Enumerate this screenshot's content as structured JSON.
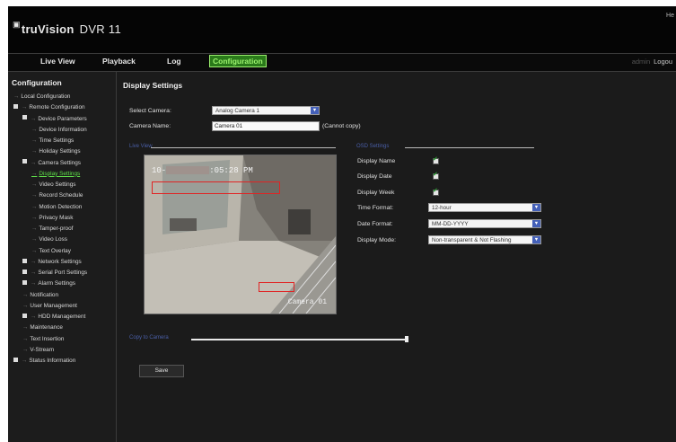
{
  "app": {
    "brand_prefix": "tru",
    "brand_word": "Vision",
    "model": "DVR 11",
    "help": "He"
  },
  "nav": {
    "items": [
      "Live View",
      "Playback",
      "Log",
      "Configuration"
    ],
    "active": "Configuration",
    "user": "admin",
    "logout": "Logou"
  },
  "sidebar": {
    "title": "Configuration",
    "items": [
      {
        "label": "Local Configuration",
        "level": 0,
        "expander": false
      },
      {
        "label": "Remote Configuration",
        "level": 0,
        "expander": true
      },
      {
        "label": "Device Parameters",
        "level": 1,
        "expander": true
      },
      {
        "label": "Device Information",
        "level": 2,
        "expander": false
      },
      {
        "label": "Time Settings",
        "level": 2,
        "expander": false
      },
      {
        "label": "Holiday Settings",
        "level": 2,
        "expander": false
      },
      {
        "label": "Camera Settings",
        "level": 1,
        "expander": true
      },
      {
        "label": "Display Settings",
        "level": 2,
        "expander": false,
        "active": true
      },
      {
        "label": "Video Settings",
        "level": 2,
        "expander": false
      },
      {
        "label": "Record Schedule",
        "level": 2,
        "expander": false
      },
      {
        "label": "Motion Detection",
        "level": 2,
        "expander": false
      },
      {
        "label": "Privacy Mask",
        "level": 2,
        "expander": false
      },
      {
        "label": "Tamper-proof",
        "level": 2,
        "expander": false
      },
      {
        "label": "Video Loss",
        "level": 2,
        "expander": false
      },
      {
        "label": "Text Overlay",
        "level": 2,
        "expander": false
      },
      {
        "label": "Network Settings",
        "level": 1,
        "expander": true
      },
      {
        "label": "Serial Port Settings",
        "level": 1,
        "expander": true
      },
      {
        "label": "Alarm Settings",
        "level": 1,
        "expander": true
      },
      {
        "label": "Notification",
        "level": 1,
        "expander": false
      },
      {
        "label": "User Management",
        "level": 1,
        "expander": false
      },
      {
        "label": "HDD Management",
        "level": 1,
        "expander": true
      },
      {
        "label": "Maintenance",
        "level": 1,
        "expander": false
      },
      {
        "label": "Text Insertion",
        "level": 1,
        "expander": false
      },
      {
        "label": "V-Stream",
        "level": 1,
        "expander": false
      },
      {
        "label": "Status Information",
        "level": 0,
        "expander": true
      }
    ]
  },
  "main": {
    "title": "Display Settings",
    "select_camera_label": "Select Camera:",
    "select_camera_value": "Analog Camera 1",
    "camera_name_label": "Camera Name:",
    "camera_name_value": "Camera 01",
    "cannot_copy": "(Cannot copy)",
    "live_view_label": "Live View",
    "osd_label": "OSD Settings",
    "copy_label": "Copy to Camera",
    "save_label": "Save"
  },
  "osd": {
    "display_name_label": "Display Name",
    "display_name": true,
    "display_date_label": "Display Date",
    "display_date": true,
    "display_week_label": "Display Week",
    "display_week": true,
    "time_format_label": "Time Format:",
    "time_format_value": "12-hour",
    "date_format_label": "Date Format:",
    "date_format_value": "MM-DD-YYYY",
    "display_mode_label": "Display Mode:",
    "display_mode_value": "Non-transparent & Not Flashing"
  },
  "preview": {
    "time_prefix": "10-",
    "time_suffix": ":05:28 PM",
    "camera_name": "Camera 01"
  },
  "colors": {
    "active_nav_bg": "#2a7a1a",
    "active_nav_text": "#9cf26e",
    "active_tree": "#5fe04a",
    "section_label": "#4a5fa8",
    "motion_box": "#e02424"
  }
}
